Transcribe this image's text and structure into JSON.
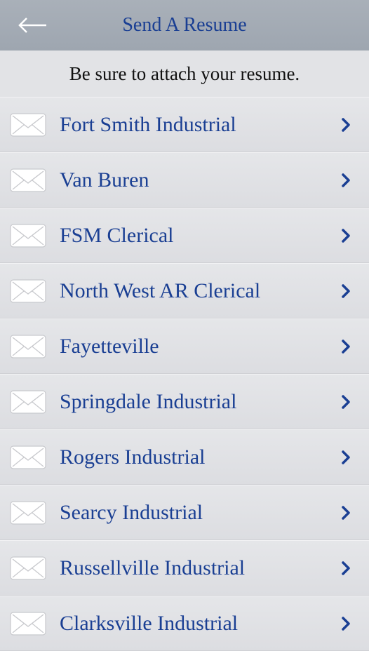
{
  "header": {
    "back_icon": "arrow-left-icon",
    "title": "Send A Resume"
  },
  "notice": "Be sure to attach your resume.",
  "locations": [
    {
      "label": "Fort Smith Industrial",
      "icon": "envelope-icon"
    },
    {
      "label": "Van Buren",
      "icon": "envelope-icon"
    },
    {
      "label": "FSM Clerical",
      "icon": "envelope-icon"
    },
    {
      "label": "North West AR Clerical",
      "icon": "envelope-icon"
    },
    {
      "label": "Fayetteville",
      "icon": "envelope-icon"
    },
    {
      "label": "Springdale Industrial",
      "icon": "envelope-icon"
    },
    {
      "label": "Rogers Industrial",
      "icon": "envelope-icon"
    },
    {
      "label": "Searcy Industrial",
      "icon": "envelope-icon"
    },
    {
      "label": "Russellville Industrial",
      "icon": "envelope-icon"
    },
    {
      "label": "Clarksville Industrial",
      "icon": "envelope-icon"
    }
  ],
  "colors": {
    "header_bg": "#a4abb5",
    "accent_text": "#1a3f93",
    "row_bg": "#e1e2e5"
  }
}
